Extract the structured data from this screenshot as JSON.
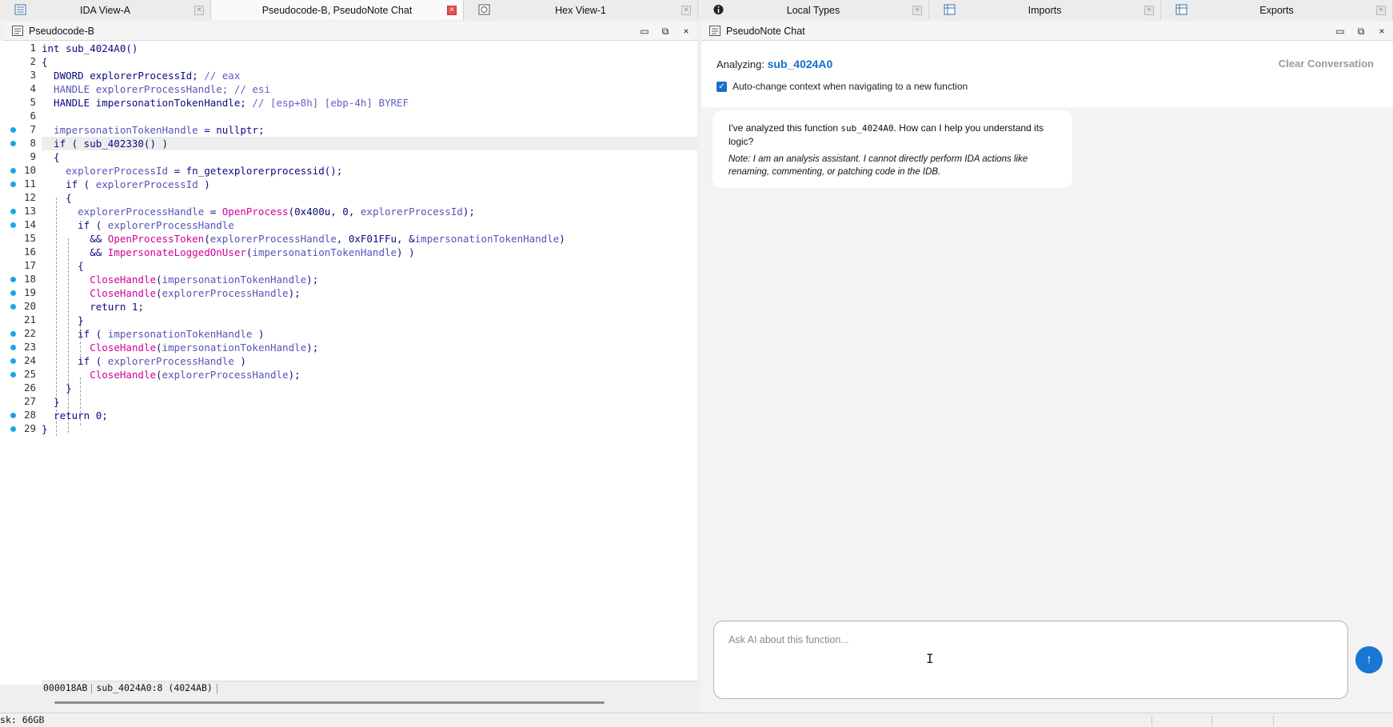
{
  "tabs": [
    {
      "label": "IDA View-A",
      "icon": "listing-icon",
      "active": false
    },
    {
      "label": "Pseudocode-B, PseudoNote Chat",
      "icon": "",
      "active": true
    },
    {
      "label": "Hex View-1",
      "icon": "hex-icon",
      "active": false
    },
    {
      "label": "Local Types",
      "icon": "info-icon",
      "active": false
    },
    {
      "label": "Imports",
      "icon": "table-icon",
      "active": false
    },
    {
      "label": "Exports",
      "icon": "table-icon",
      "active": false
    }
  ],
  "code_panel": {
    "title": "Pseudocode-B",
    "window_buttons": {
      "minimize": "▭",
      "float": "⧉",
      "close": "×"
    },
    "line_numbers": [
      "1",
      "2",
      "3",
      "4",
      "5",
      "6",
      "7",
      "8",
      "9",
      "10",
      "11",
      "12",
      "13",
      "14",
      "15",
      "16",
      "17",
      "18",
      "19",
      "20",
      "21",
      "22",
      "23",
      "24",
      "25",
      "26",
      "27",
      "28",
      "29"
    ],
    "breakpoint_lines": [
      7,
      8,
      10,
      11,
      13,
      14,
      18,
      19,
      20,
      22,
      23,
      24,
      25,
      28,
      29
    ],
    "highlighted_line": 8,
    "lines": [
      [
        {
          "t": "int sub_4024A0()",
          "c": "kw"
        }
      ],
      [
        {
          "t": "{",
          "c": "kw"
        }
      ],
      [
        {
          "t": "  DWORD explorerProcessId; ",
          "c": "kw"
        },
        {
          "t": "// eax",
          "c": "cmt"
        }
      ],
      [
        {
          "t": "  HANDLE explorerProcessHandle; ",
          "c": "var"
        },
        {
          "t": "// esi",
          "c": "cmt"
        }
      ],
      [
        {
          "t": "  HANDLE impersonationTokenHandle; ",
          "c": "kw"
        },
        {
          "t": "// [esp+8h] [ebp-4h] BYREF",
          "c": "cmt"
        }
      ],
      [
        {
          "t": "",
          "c": "kw"
        }
      ],
      [
        {
          "t": "  ",
          "c": "kw"
        },
        {
          "t": "impersonationTokenHandle",
          "c": "var"
        },
        {
          "t": " = nullptr;",
          "c": "kw"
        }
      ],
      [
        {
          "t": "  if ( sub_402330() )",
          "c": "kw"
        }
      ],
      [
        {
          "t": "  {",
          "c": "kw"
        }
      ],
      [
        {
          "t": "    ",
          "c": "kw"
        },
        {
          "t": "explorerProcessId",
          "c": "var"
        },
        {
          "t": " = fn_getexplorerprocessid();",
          "c": "kw"
        }
      ],
      [
        {
          "t": "    if ( ",
          "c": "kw"
        },
        {
          "t": "explorerProcessId",
          "c": "var"
        },
        {
          "t": " )",
          "c": "kw"
        }
      ],
      [
        {
          "t": "    {",
          "c": "kw"
        }
      ],
      [
        {
          "t": "      ",
          "c": "kw"
        },
        {
          "t": "explorerProcessHandle",
          "c": "var"
        },
        {
          "t": " = ",
          "c": "kw"
        },
        {
          "t": "OpenProcess",
          "c": "api"
        },
        {
          "t": "(0x400u, 0, ",
          "c": "kw"
        },
        {
          "t": "explorerProcessId",
          "c": "var"
        },
        {
          "t": ");",
          "c": "kw"
        }
      ],
      [
        {
          "t": "      if ( ",
          "c": "kw"
        },
        {
          "t": "explorerProcessHandle",
          "c": "var"
        }
      ],
      [
        {
          "t": "        && ",
          "c": "kw"
        },
        {
          "t": "OpenProcessToken",
          "c": "api"
        },
        {
          "t": "(",
          "c": "kw"
        },
        {
          "t": "explorerProcessHandle",
          "c": "var"
        },
        {
          "t": ", 0xF01FFu, &",
          "c": "kw"
        },
        {
          "t": "impersonationTokenHandle",
          "c": "var"
        },
        {
          "t": ")",
          "c": "kw"
        }
      ],
      [
        {
          "t": "        && ",
          "c": "kw"
        },
        {
          "t": "ImpersonateLoggedOnUser",
          "c": "api"
        },
        {
          "t": "(",
          "c": "kw"
        },
        {
          "t": "impersonationTokenHandle",
          "c": "var"
        },
        {
          "t": ") )",
          "c": "kw"
        }
      ],
      [
        {
          "t": "      {",
          "c": "kw"
        }
      ],
      [
        {
          "t": "        ",
          "c": "kw"
        },
        {
          "t": "CloseHandle",
          "c": "api"
        },
        {
          "t": "(",
          "c": "kw"
        },
        {
          "t": "impersonationTokenHandle",
          "c": "var"
        },
        {
          "t": ");",
          "c": "kw"
        }
      ],
      [
        {
          "t": "        ",
          "c": "kw"
        },
        {
          "t": "CloseHandle",
          "c": "api"
        },
        {
          "t": "(",
          "c": "kw"
        },
        {
          "t": "explorerProcessHandle",
          "c": "var"
        },
        {
          "t": ");",
          "c": "kw"
        }
      ],
      [
        {
          "t": "        return 1;",
          "c": "kw"
        }
      ],
      [
        {
          "t": "      }",
          "c": "kw"
        }
      ],
      [
        {
          "t": "      if ( ",
          "c": "kw"
        },
        {
          "t": "impersonationTokenHandle",
          "c": "var"
        },
        {
          "t": " )",
          "c": "kw"
        }
      ],
      [
        {
          "t": "        ",
          "c": "kw"
        },
        {
          "t": "CloseHandle",
          "c": "api"
        },
        {
          "t": "(",
          "c": "kw"
        },
        {
          "t": "impersonationTokenHandle",
          "c": "var"
        },
        {
          "t": ");",
          "c": "kw"
        }
      ],
      [
        {
          "t": "      if ( ",
          "c": "kw"
        },
        {
          "t": "explorerProcessHandle",
          "c": "var"
        },
        {
          "t": " )",
          "c": "kw"
        }
      ],
      [
        {
          "t": "        ",
          "c": "kw"
        },
        {
          "t": "CloseHandle",
          "c": "api"
        },
        {
          "t": "(",
          "c": "kw"
        },
        {
          "t": "explorerProcessHandle",
          "c": "var"
        },
        {
          "t": ");",
          "c": "kw"
        }
      ],
      [
        {
          "t": "    }",
          "c": "kw"
        }
      ],
      [
        {
          "t": "  }",
          "c": "kw"
        }
      ],
      [
        {
          "t": "  return 0;",
          "c": "kw"
        }
      ],
      [
        {
          "t": "}",
          "c": "kw"
        }
      ]
    ],
    "status": {
      "address": "000018AB",
      "location": "sub_4024A0:8 (4024AB)"
    }
  },
  "chat_panel": {
    "title": "PseudoNote Chat",
    "window_buttons": {
      "minimize": "▭",
      "float": "⧉",
      "close": "×"
    },
    "analyzing_label": "Analyzing:",
    "function_name": "sub_4024A0",
    "clear_button": "Clear Conversation",
    "auto_change_label": "Auto-change context when navigating to a new function",
    "auto_change_checked": true,
    "message": {
      "prefix": "I've analyzed this function ",
      "function_ref": "sub_4024A0",
      "suffix": ". How can I help you understand its logic?",
      "note": "Note: I am an analysis assistant. I cannot directly perform IDA actions like renaming, commenting, or patching code in the IDB."
    },
    "input_placeholder": "Ask AI about this function...",
    "send_icon": "↑"
  },
  "statusbar": {
    "disk": "sk: 66GB"
  },
  "colors": {
    "accent": "#1976d2",
    "breakpoint": "#1aa6e8",
    "api": "#d0009a",
    "variable": "#5454b8",
    "keyword": "#0b0b80"
  }
}
